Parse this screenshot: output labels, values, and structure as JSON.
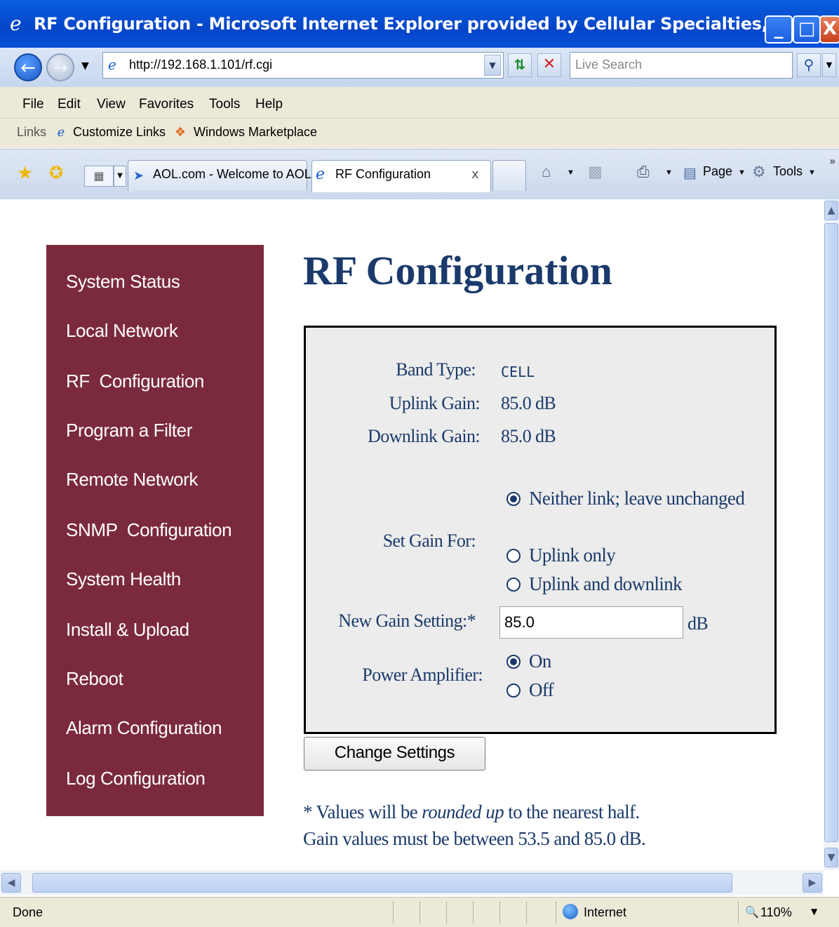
{
  "window": {
    "title": "RF Configuration - Microsoft Internet Explorer provided by Cellular Specialties, Inc.",
    "minimize": "_",
    "maximize": "□",
    "close": "X"
  },
  "address_bar": {
    "url": "http://192.168.1.101/rf.cgi",
    "search_placeholder": "Live Search"
  },
  "menu": [
    "File",
    "Edit",
    "View",
    "Favorites",
    "Tools",
    "Help"
  ],
  "links_bar": {
    "label": "Links",
    "items": [
      "Customize Links",
      "Windows Marketplace"
    ]
  },
  "tabs": {
    "items": [
      {
        "label": "AOL.com - Welcome to AOL",
        "active": false
      },
      {
        "label": "RF Configuration",
        "active": true
      }
    ],
    "close_glyph": "x"
  },
  "command_bar": {
    "page_label": "Page",
    "tools_label": "Tools"
  },
  "sidebar": {
    "items": [
      "System Status",
      "Local Network",
      "RF  Configuration",
      "Program a Filter",
      "Remote Network",
      "SNMP  Configuration",
      "System Health",
      "Install & Upload",
      "Reboot",
      "Alarm Configuration",
      "Log Configuration"
    ]
  },
  "page": {
    "title": "RF Configuration",
    "band_type_label": "Band Type:",
    "band_type_value": "CELL",
    "uplink_gain_label": "Uplink Gain:",
    "uplink_gain_value": "85.0 dB",
    "downlink_gain_label": "Downlink Gain:",
    "downlink_gain_value": "85.0 dB",
    "set_gain_label": "Set Gain For:",
    "set_gain_options": [
      {
        "label": "Neither link; leave unchanged",
        "selected": true
      },
      {
        "label": "Uplink only",
        "selected": false
      },
      {
        "label": "Uplink and downlink",
        "selected": false
      }
    ],
    "new_gain_label": "New Gain Setting:*",
    "new_gain_value": "85.0",
    "new_gain_unit": "dB",
    "power_amp_label": "Power Amplifier:",
    "power_amp_options": [
      {
        "label": "On",
        "selected": true
      },
      {
        "label": "Off",
        "selected": false
      }
    ],
    "submit_label": "Change Settings",
    "note_prefix": "* Values will be ",
    "note_emphasis": "rounded up",
    "note_suffix": " to the nearest half.",
    "note_line2": "Gain values must be between 53.5 and 85.0 dB."
  },
  "status_bar": {
    "status": "Done",
    "zone": "Internet",
    "zoom": "110%"
  }
}
